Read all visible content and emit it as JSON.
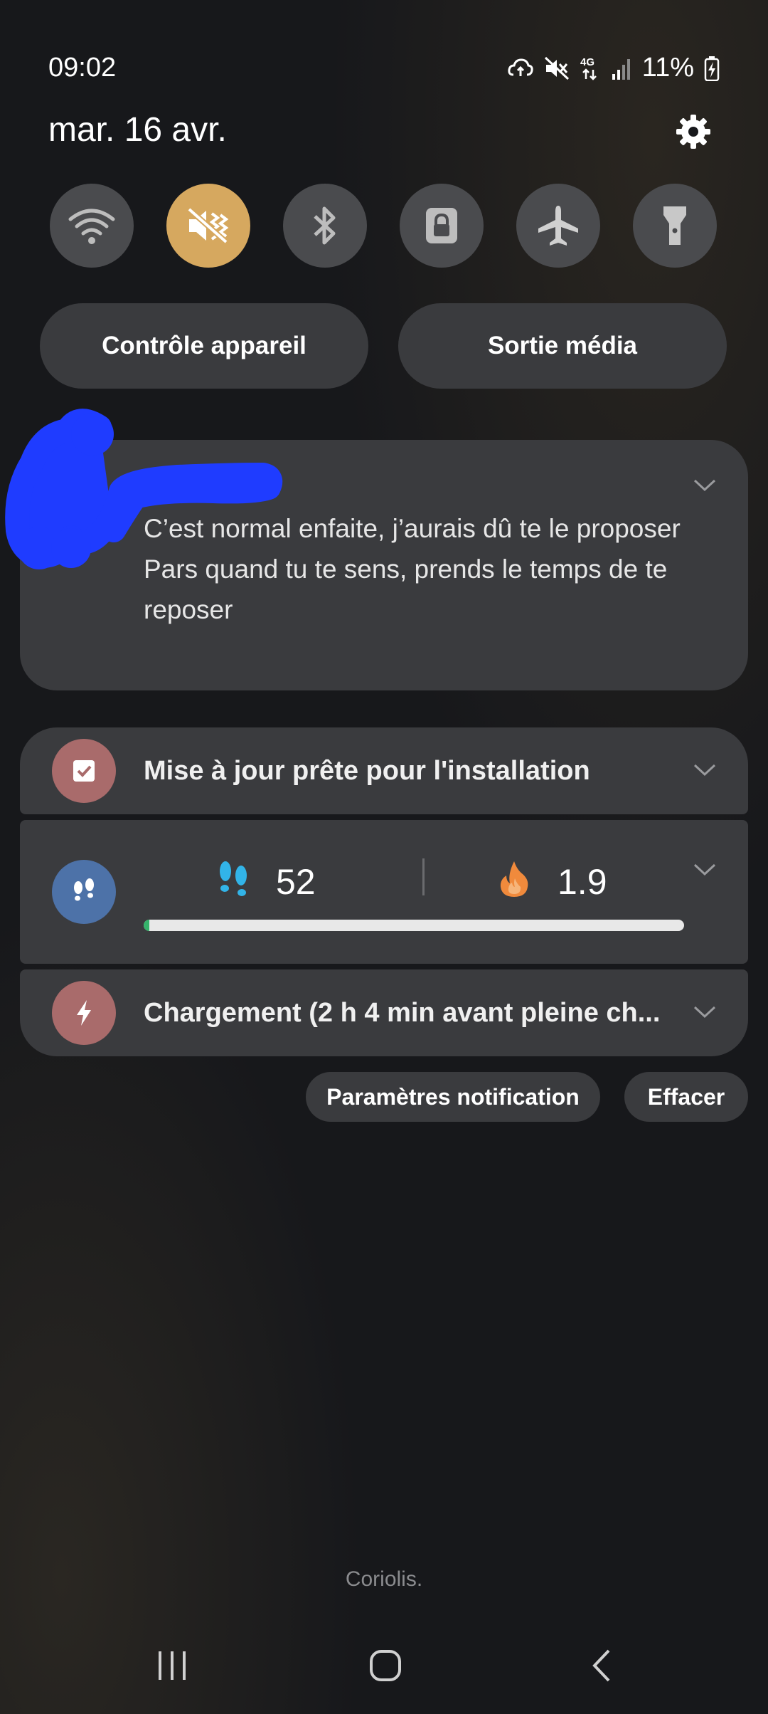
{
  "status_bar": {
    "time": "09:02",
    "battery": "11%",
    "icons": [
      "cloud-sync-icon",
      "mute-icon",
      "4g-icon",
      "signal-icon",
      "battery-charging-icon"
    ]
  },
  "header": {
    "date": "mar. 16 avr.",
    "settings_icon": "gear-icon"
  },
  "quick_toggles": [
    {
      "name": "wifi",
      "icon": "wifi-icon",
      "active": false
    },
    {
      "name": "sound",
      "icon": "mute-icon",
      "active": true
    },
    {
      "name": "bluetooth",
      "icon": "bluetooth-icon",
      "active": false
    },
    {
      "name": "rotation-lock",
      "icon": "lock-icon",
      "active": false
    },
    {
      "name": "airplane",
      "icon": "airplane-icon",
      "active": false
    },
    {
      "name": "flashlight",
      "icon": "flashlight-icon",
      "active": false
    }
  ],
  "buttons": {
    "device_control": "Contrôle appareil",
    "media_output": "Sortie média"
  },
  "notifications": {
    "message": {
      "line1": "C’est normal enfaite, j’aurais dû te le proposer",
      "line2": "Pars quand tu te sens, prends le temps de te reposer"
    },
    "update": {
      "title": "Mise à jour prête pour l'installation"
    },
    "health": {
      "steps": "52",
      "calories": "1.9",
      "progress": 0.01
    },
    "charging": {
      "title": "Chargement (2 h 4 min avant pleine ch..."
    }
  },
  "actions": {
    "notification_settings": "Paramètres notification",
    "clear": "Effacer"
  },
  "carrier": "Coriolis.",
  "colors": {
    "accent_toggle": "#d6a85f",
    "update_icon_bg": "#a96b6b",
    "health_icon_bg": "#4d72a8",
    "charge_icon_bg": "#a96b6b",
    "steps_icon": "#32b4e8",
    "calories_icon": "#f08a3c",
    "redaction": "#1f3cff"
  }
}
